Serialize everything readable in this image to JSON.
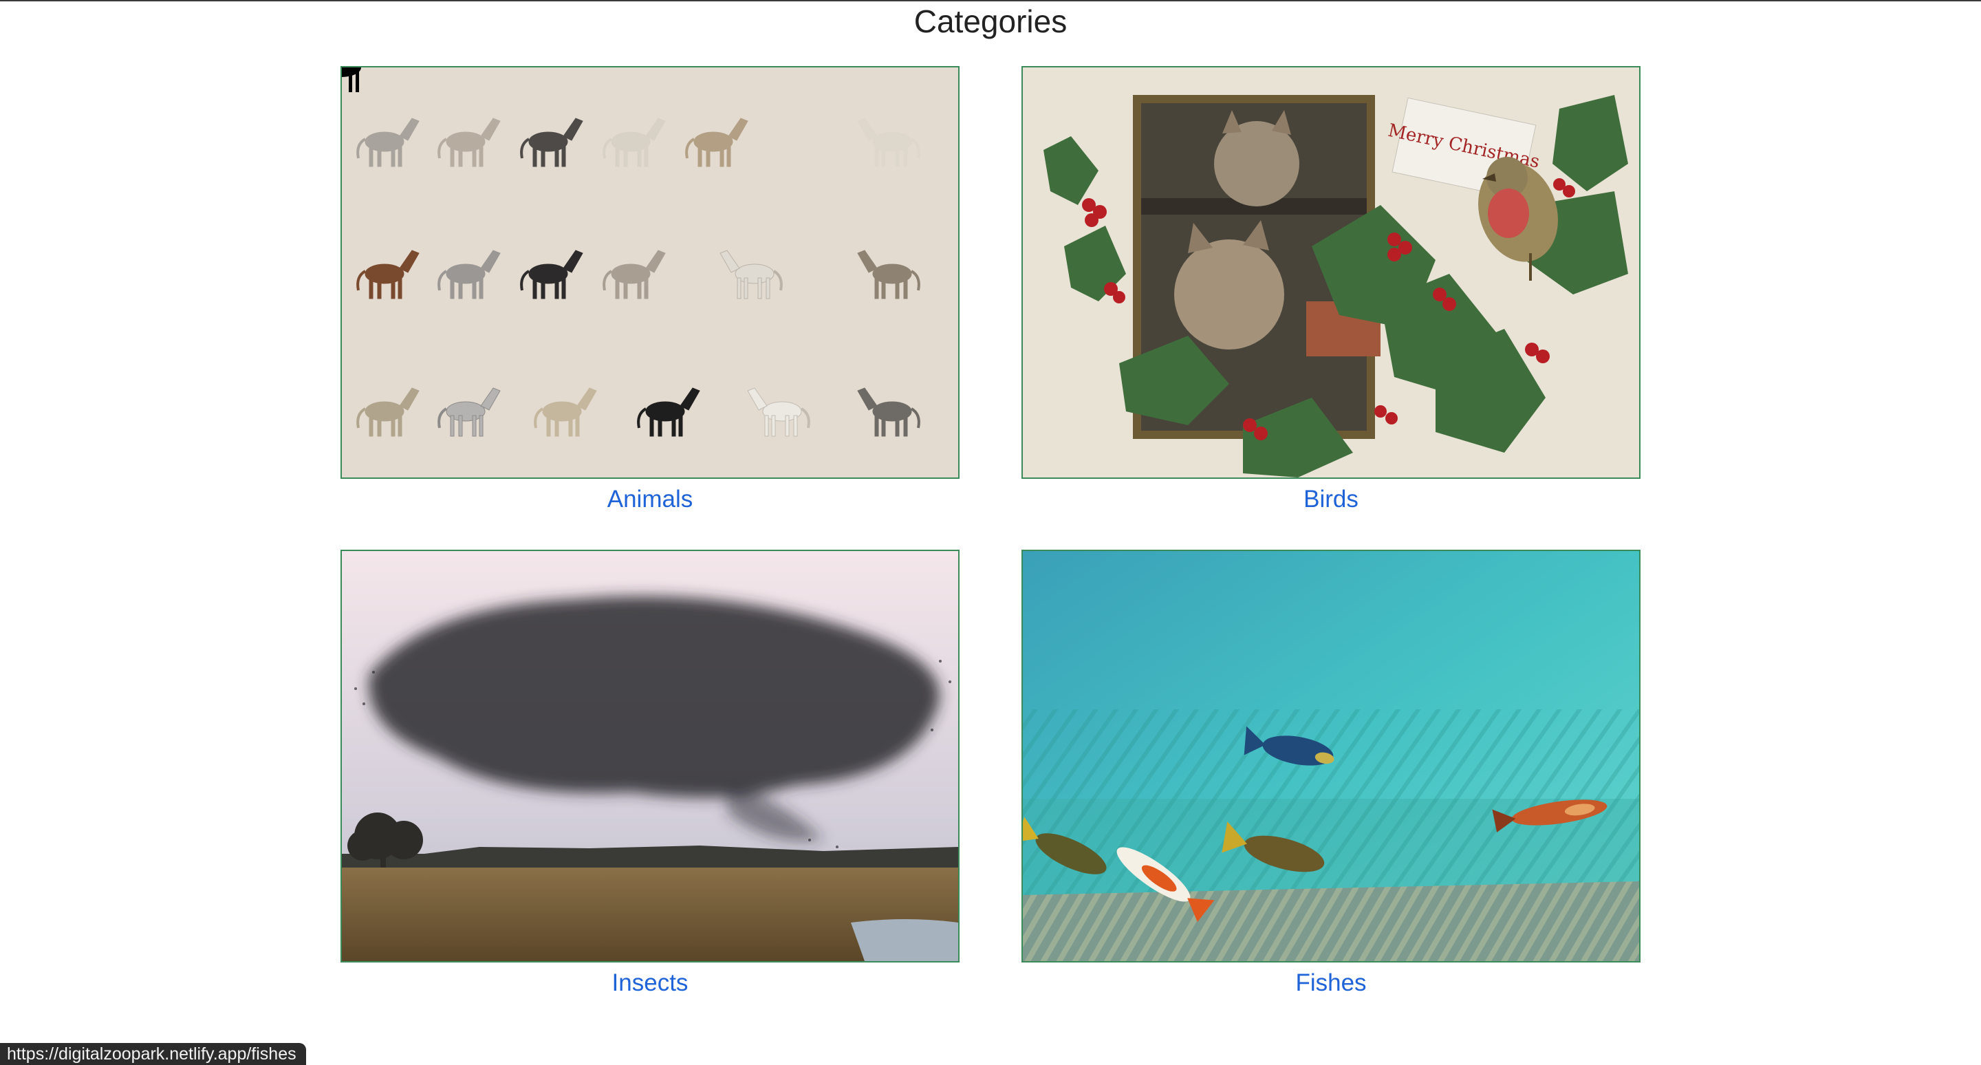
{
  "page": {
    "title": "Categories"
  },
  "categories": [
    {
      "label": "Animals",
      "image": "horse-studies-scroll-painting"
    },
    {
      "label": "Birds",
      "image": "merry-christmas-kittens-robin-card"
    },
    {
      "label": "Insects",
      "image": "starling-murmuration-over-marsh"
    },
    {
      "label": "Fishes",
      "image": "koi-fish-in-pool"
    }
  ],
  "card_art": {
    "text": "Merry Christmas"
  },
  "status_bar": {
    "url": "https://digitalzoopark.netlify.app/fishes"
  },
  "colors": {
    "accent_link": "#1f63d8",
    "card_border": "#3a8a5a",
    "title_text": "#222222"
  }
}
